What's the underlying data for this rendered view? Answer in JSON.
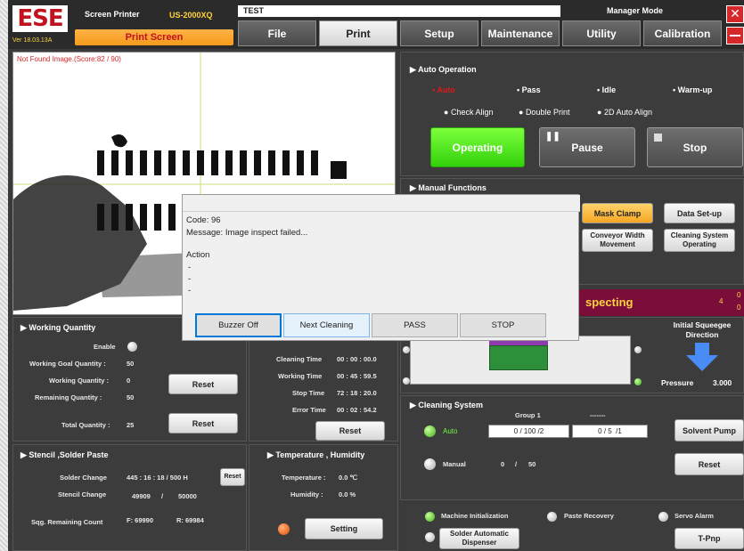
{
  "app": {
    "logo_text": "ESE",
    "version": "Ver 18.03.13A",
    "name": "Screen Printer",
    "model": "US-2000XQ",
    "screen_name": "Print Screen",
    "job": "TEST",
    "mode": "Manager Mode"
  },
  "tabs": [
    "File",
    "Print",
    "Setup",
    "Maintenance",
    "Utility",
    "Calibration"
  ],
  "camera": {
    "status": "Not Found Image.(Score:82 / 90)"
  },
  "auto": {
    "title": "Auto Operation",
    "options": [
      "Auto",
      "Pass",
      "Idle",
      "Warm-up"
    ],
    "checks": [
      "Check Align",
      "Double Print",
      "2D Auto Align"
    ],
    "operating": "Operating",
    "pause": "Pause",
    "stop": "Stop"
  },
  "manual": {
    "title": "Manual Functions",
    "mask_clamp": "Mask Clamp",
    "data_setup": "Data Set-up",
    "conveyor": "Conveyor Width Movement",
    "cleaning_op": "Cleaning System Operating"
  },
  "inspecting": {
    "text": "specting",
    "count": "4",
    "side_top": "0",
    "side_bot": "0"
  },
  "squeegee": {
    "title": "Initial Squeegee Direction",
    "pressure_label": "Pressure",
    "pressure_value": "3.000"
  },
  "working": {
    "title": "Working Quantity",
    "enable": "Enable",
    "goal_label": "Working Goal Quantity :",
    "goal": "50",
    "working_label": "Working Quantity :",
    "working": "0",
    "remaining_label": "Remaining Quantity :",
    "remaining": "50",
    "total_label": "Total Quantity :",
    "total": "25",
    "reset": "Reset"
  },
  "times": {
    "cleaning_label": "Cleaning Time",
    "cleaning": "00 : 00 : 00.0",
    "working_label": "Working Time",
    "working": "00 : 45 : 59.5",
    "stop_label": "Stop Time",
    "stop": "72 : 18 : 20.0",
    "error_label": "Error Time",
    "error": "00 : 02 : 54.2",
    "reset": "Reset"
  },
  "stencil": {
    "title": "Stencil ,Solder Paste",
    "solder_label": "Solder Change",
    "solder": "445 : 16 : 18  /  500 H",
    "stencil_label": "Stencil Change",
    "stencil_value": "49909",
    "stencil_max": "50000",
    "sqg_label": "Sqg. Remaining Count",
    "sqg_f": "F: 69990",
    "sqg_r": "R: 69984",
    "reset": "Reset"
  },
  "temp": {
    "title": "Temperature , Humidity",
    "temp_label": "Temperature :",
    "temp": "0.0 ℃",
    "hum_label": "Humidity :",
    "hum": "0.0 %",
    "setting": "Setting"
  },
  "cleaning": {
    "title": "Cleaning System",
    "group": "Group 1",
    "group2": "-------",
    "auto": "Auto",
    "manual": "Manual",
    "f1a": "0",
    "f1b": "100",
    "f1c": "2",
    "f2a": "0",
    "f2b": "5",
    "f2c": "1",
    "manual_a": "0",
    "manual_b": "50",
    "solvent": "Solvent Pump",
    "reset": "Reset"
  },
  "status": {
    "machine_init": "Machine Initialization",
    "paste_recovery": "Paste Recovery",
    "servo_alarm": "Servo Alarm",
    "solder_disp": "Solder Automatic Dispenser",
    "tpnp": "T-Pnp"
  },
  "dialog": {
    "code": "Code: 96",
    "message": "Message: Image inspect failed...",
    "action": "Action",
    "lines": [
      "-",
      "-",
      "-"
    ],
    "buttons": [
      "Buzzer Off",
      "Next Cleaning",
      "PASS",
      "STOP"
    ]
  }
}
